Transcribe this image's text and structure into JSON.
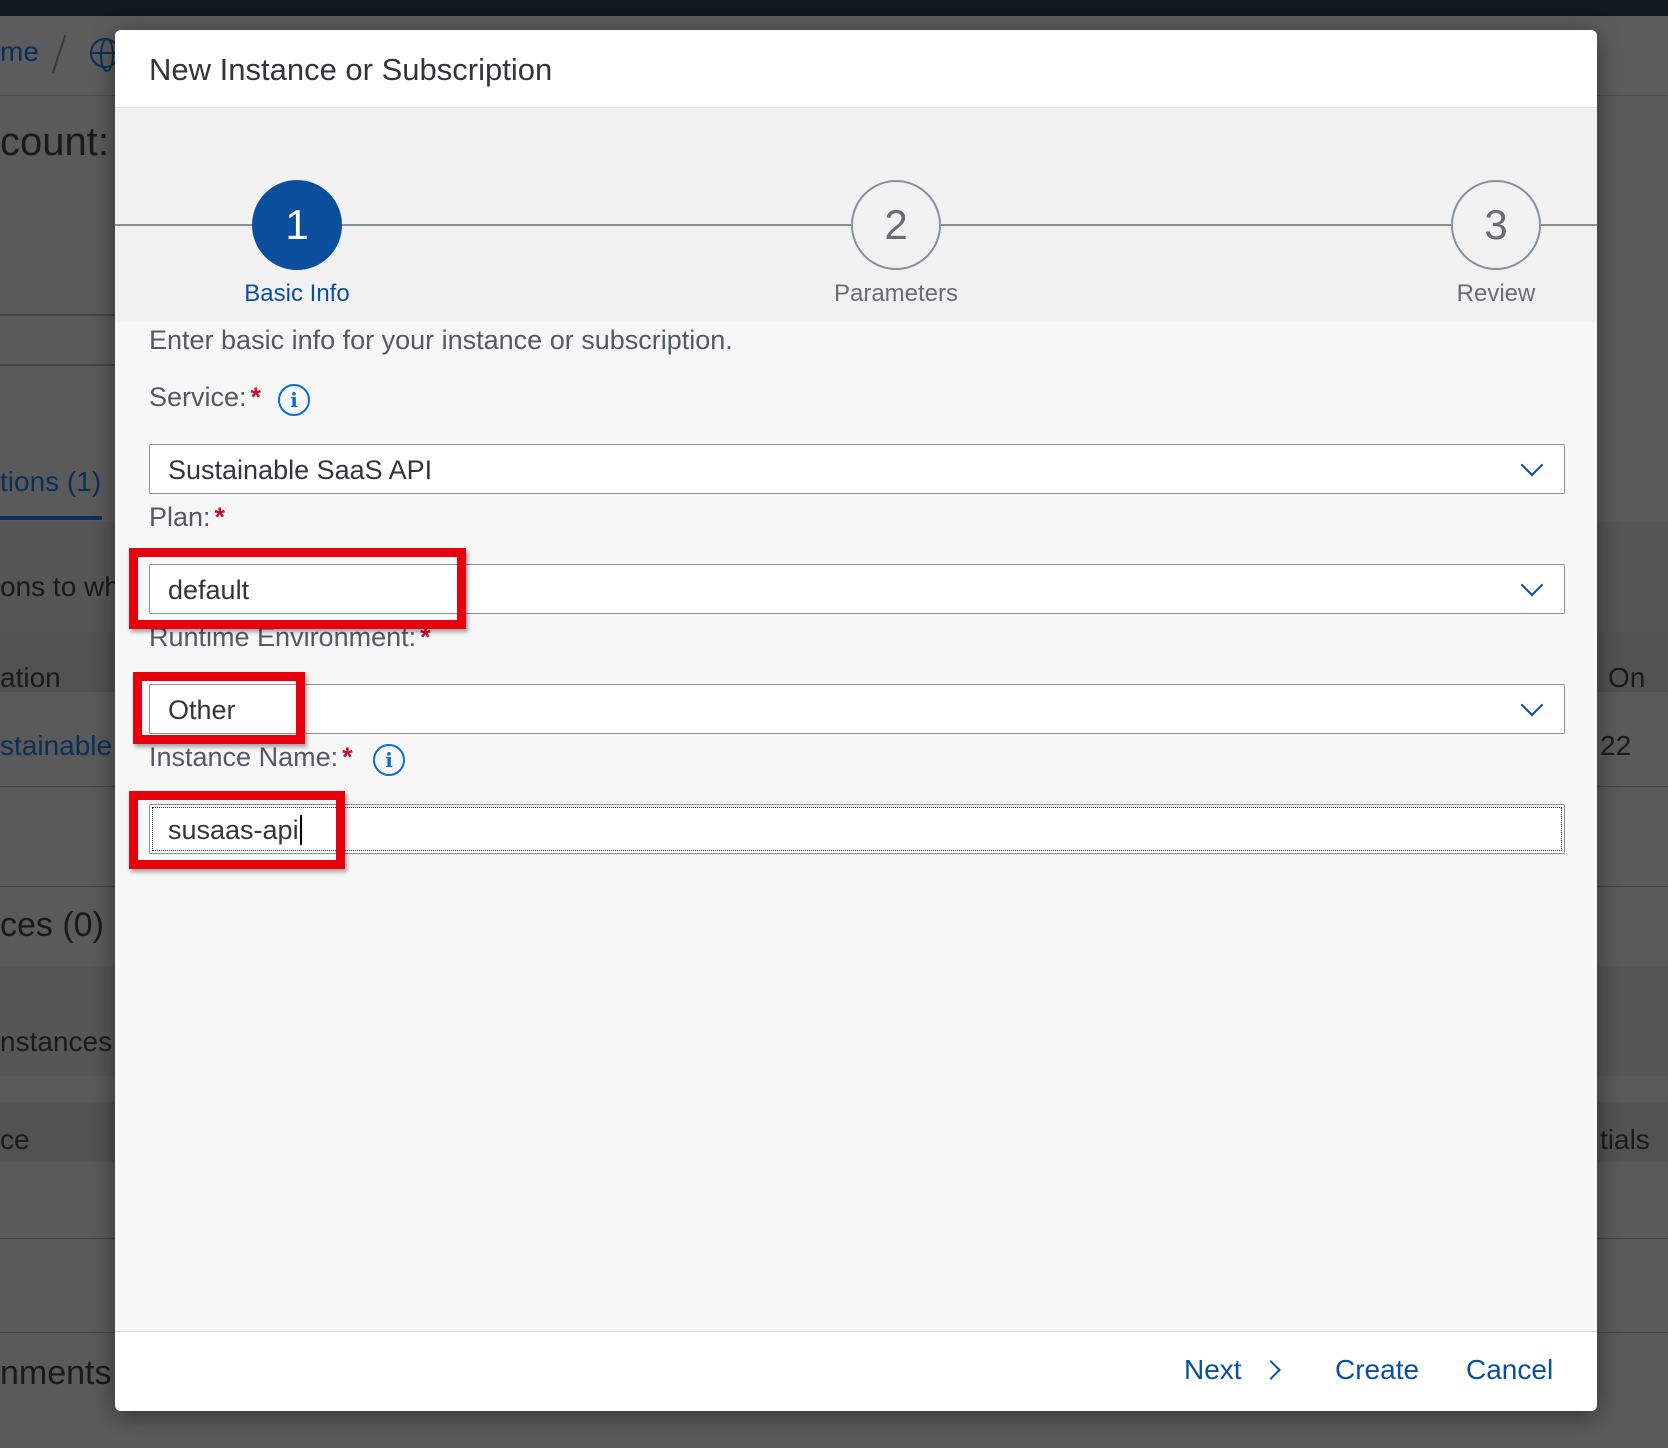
{
  "background": {
    "breadcrumb_fragment": "me",
    "heading_fragment": "count:",
    "tab_fragment": "tions (1)",
    "desc_fragment": "ons to wh",
    "col1_fragment": "ation",
    "col_right_fragment": "On",
    "row_link_fragment": "stainable",
    "row_right_fragment": "22",
    "section2_fragment": "ces (0)",
    "section2_desc_fragment": "nstances c",
    "col2_fragment": "ce",
    "col2_right_fragment": "tials",
    "section3_fragment": "nments"
  },
  "dialog": {
    "title": "New Instance or Subscription",
    "wizard": {
      "steps": [
        {
          "number": "1",
          "label": "Basic Info",
          "active": true
        },
        {
          "number": "2",
          "label": "Parameters",
          "active": false
        },
        {
          "number": "3",
          "label": "Review",
          "active": false
        }
      ]
    },
    "intro": "Enter basic info for your instance or subscription.",
    "fields": {
      "service": {
        "label": "Service:",
        "required": "*",
        "value": "Sustainable SaaS API",
        "icon": "info-icon"
      },
      "plan": {
        "label": "Plan:",
        "required": "*",
        "value": "default"
      },
      "runtime": {
        "label": "Runtime Environment:",
        "required": "*",
        "value": "Other"
      },
      "instance_name": {
        "label": "Instance Name:",
        "required": "*",
        "value": "susaas-api",
        "icon": "info-icon"
      }
    },
    "footer": {
      "next": "Next",
      "create": "Create",
      "cancel": "Cancel"
    }
  },
  "colors": {
    "accent": "#0a4f9e",
    "highlight": "#e8000d",
    "required": "#c8102e"
  }
}
